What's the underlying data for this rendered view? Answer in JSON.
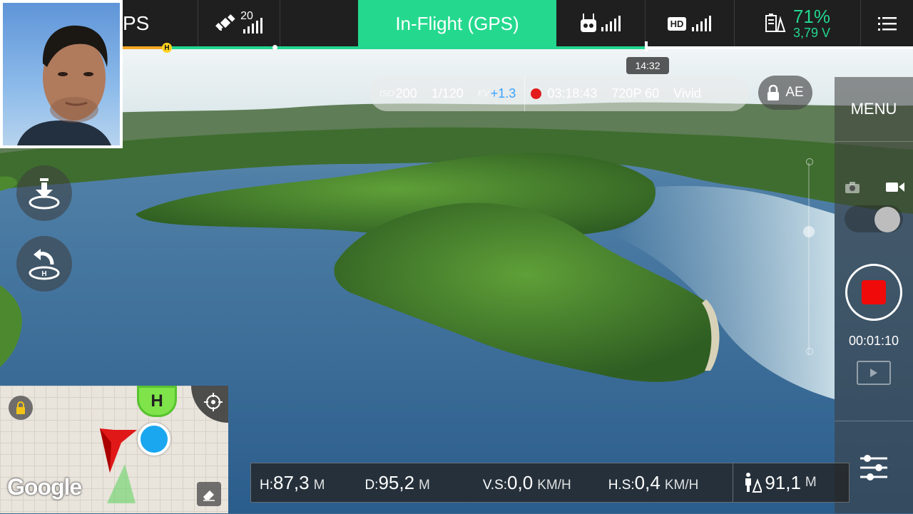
{
  "topbar": {
    "mode_label": "PS",
    "satellite_count": "20",
    "flight_mode": "In-Flight (GPS)",
    "hd_label": "HD",
    "battery_percent": "71%",
    "battery_voltage": "3,79 V",
    "flight_time_tip": "14:32"
  },
  "camera": {
    "iso_label": "ISO",
    "iso_value": "200",
    "shutter": "1/120",
    "ev_label": "EV",
    "ev_value": "+1.3",
    "rec_time": "03:18:43",
    "resolution": "720P 60",
    "color_profile": "Vivid",
    "ae_label": "AE"
  },
  "right_panel": {
    "menu_label": "MENU",
    "record_time": "00:01:10"
  },
  "telemetry": {
    "h_label": "H:",
    "h_value": "87,3",
    "h_unit": "M",
    "d_label": "D:",
    "d_value": "95,2",
    "d_unit": "M",
    "vs_label": "V.S:",
    "vs_value": "0,0",
    "vs_unit": "KM/H",
    "hs_label": "H.S:",
    "hs_value": "0,4",
    "hs_unit": "KM/H",
    "dist_value": "91,1",
    "dist_unit": "M"
  },
  "map": {
    "home_marker": "H",
    "provider": "Google"
  },
  "progress_marker": "H",
  "colors": {
    "accent_green": "#24d98e",
    "record_red": "#f00a0a",
    "ev_blue": "#3aa3ff",
    "progress_orange": "#f5a623"
  }
}
